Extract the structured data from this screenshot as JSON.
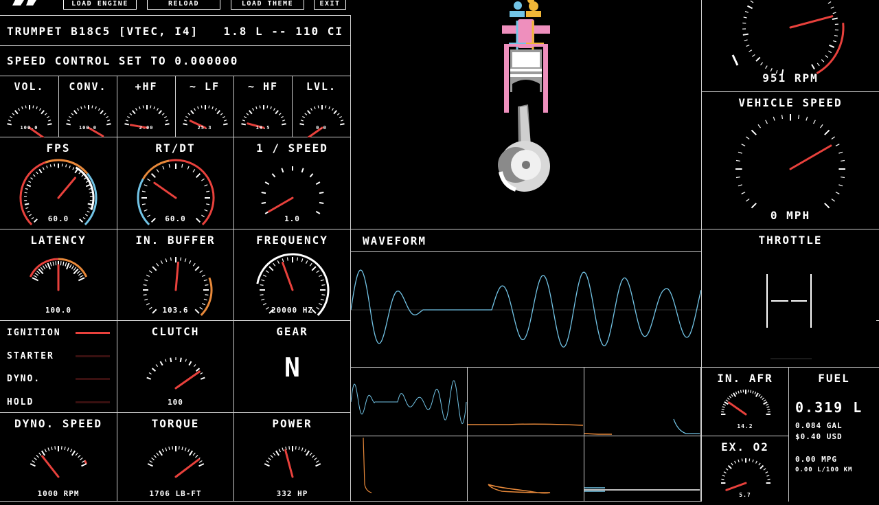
{
  "menu": {
    "load_engine": "LOAD ENGINE",
    "reload": "RELOAD",
    "load_theme": "LOAD THEME",
    "exit": "EXIT"
  },
  "engine_title": "TRUMPET B18C5 [VTEC, I4]",
  "engine_spec": "1.8 L -- 110 CI",
  "speed_control": "SPEED CONTROL SET TO 0.000000",
  "mixer": [
    {
      "label": "VOL.",
      "value": "100.0"
    },
    {
      "label": "CONV.",
      "value": "100.0"
    },
    {
      "label": "+HF",
      "value": "2.00"
    },
    {
      "label": "~ LF",
      "value": "25.3"
    },
    {
      "label": "~ HF",
      "value": "19.5"
    },
    {
      "label": "LVL.",
      "value": "0.0"
    }
  ],
  "gauges": {
    "fps": {
      "label": "FPS",
      "value": "60.0"
    },
    "rtdt": {
      "label": "RT/DT",
      "value": "60.0"
    },
    "speed_inv": {
      "label": "1 / SPEED",
      "value": "1.0"
    },
    "latency": {
      "label": "LATENCY",
      "value": "100.0"
    },
    "in_buffer": {
      "label": "IN. BUFFER",
      "value": "103.6"
    },
    "frequency": {
      "label": "FREQUENCY",
      "value": "20000 HZ"
    },
    "clutch": {
      "label": "CLUTCH",
      "value": "100"
    },
    "dyno_speed": {
      "label": "DYNO. SPEED",
      "value": "1000 RPM"
    },
    "torque": {
      "label": "TORQUE",
      "value": "1706 LB-FT"
    },
    "power": {
      "label": "POWER",
      "value": "332 HP"
    },
    "rpm": {
      "value": "951 RPM"
    },
    "vehicle_speed": {
      "label": "VEHICLE SPEED",
      "value": "0 MPH"
    },
    "in_afr": {
      "label": "IN. AFR",
      "value": "14.2"
    },
    "ex_o2": {
      "label": "EX. O2",
      "value": "5.7"
    }
  },
  "toggles": [
    {
      "label": "IGNITION",
      "on": true
    },
    {
      "label": "STARTER",
      "on": false
    },
    {
      "label": "DYNO.",
      "on": false
    },
    {
      "label": "HOLD",
      "on": false
    }
  ],
  "gear": {
    "label": "GEAR",
    "value": "N"
  },
  "waveform": {
    "label": "WAVEFORM"
  },
  "throttle": {
    "label": "THROTTLE"
  },
  "fuel": {
    "label": "FUEL",
    "liters": "0.319 L",
    "gallons": "0.084 GAL",
    "cost": "$0.40 USD",
    "mpg": "0.00 MPG",
    "l_per_100km": "0.00 L/100 KM"
  },
  "colors": {
    "red": "#e8413c",
    "orange": "#e8893a",
    "blue": "#72c4e6",
    "pink": "#ee8fbd",
    "yellow": "#f2b737",
    "grid": "#cfcfcf"
  }
}
